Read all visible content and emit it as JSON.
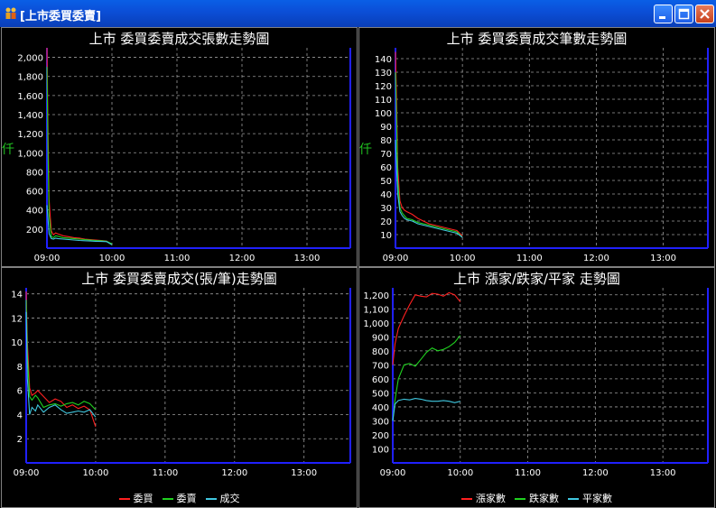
{
  "window": {
    "title": "[上市委買委賣]"
  },
  "panels": [
    {
      "title": "上市  委買委賣成交張數走勢圖",
      "ylabel": "仟",
      "legend": [],
      "chart_data": {
        "type": "line",
        "title": "上市  委買委賣成交張數走勢圖",
        "ylabel": "仟",
        "x_ticks": [
          "09:00",
          "10:00",
          "11:00",
          "12:00",
          "13:00"
        ],
        "x_range": [
          "09:00",
          "13:40"
        ],
        "y_ticks": [
          200,
          400,
          600,
          800,
          1000,
          1200,
          1400,
          1600,
          1800,
          2000
        ],
        "y_tick_labels": [
          "200",
          "400",
          "600",
          "800",
          "1,000",
          "1,200",
          "1,400",
          "1,600",
          "1,800",
          "2,000"
        ],
        "ylim": [
          0,
          2100
        ],
        "grid": true,
        "series": [
          {
            "color": "#ff2020",
            "x": [
              "09:00",
              "09:01",
              "09:02",
              "09:04",
              "09:06",
              "09:08",
              "09:10",
              "09:15",
              "09:20",
              "09:25",
              "09:30",
              "09:35",
              "09:40",
              "09:45",
              "09:50",
              "09:55",
              "10:00"
            ],
            "values": [
              2100,
              1200,
              500,
              180,
              140,
              160,
              150,
              130,
              120,
              110,
              105,
              95,
              90,
              85,
              80,
              75,
              40
            ]
          },
          {
            "color": "#20d020",
            "x": [
              "09:00",
              "09:01",
              "09:02",
              "09:04",
              "09:06",
              "09:08",
              "09:10",
              "09:15",
              "09:20",
              "09:25",
              "09:30",
              "09:35",
              "09:40",
              "09:45",
              "09:50",
              "09:55",
              "10:00"
            ],
            "values": [
              1900,
              1000,
              350,
              120,
              110,
              130,
              125,
              110,
              105,
              100,
              95,
              90,
              85,
              80,
              78,
              72,
              45
            ]
          },
          {
            "color": "#40c8e0",
            "x": [
              "09:00",
              "09:01",
              "09:02",
              "09:04",
              "09:06",
              "09:08",
              "09:10",
              "09:15",
              "09:20",
              "09:25",
              "09:30",
              "09:35",
              "09:40",
              "09:45",
              "09:50",
              "09:55",
              "10:00"
            ],
            "values": [
              450,
              300,
              150,
              100,
              95,
              105,
              100,
              95,
              90,
              85,
              80,
              78,
              75,
              72,
              70,
              68,
              35
            ]
          }
        ]
      }
    },
    {
      "title": "上市  委買委賣成交筆數走勢圖",
      "ylabel": "仟",
      "legend": [],
      "chart_data": {
        "type": "line",
        "title": "上市  委買委賣成交筆數走勢圖",
        "ylabel": "仟",
        "x_ticks": [
          "09:00",
          "10:00",
          "11:00",
          "12:00",
          "13:00"
        ],
        "x_range": [
          "09:00",
          "13:40"
        ],
        "y_ticks": [
          10,
          20,
          30,
          40,
          50,
          60,
          70,
          80,
          90,
          100,
          110,
          120,
          130,
          140
        ],
        "y_tick_labels": [
          "10",
          "20",
          "30",
          "40",
          "50",
          "60",
          "70",
          "80",
          "90",
          "100",
          "110",
          "120",
          "130",
          "140"
        ],
        "ylim": [
          0,
          148
        ],
        "grid": true,
        "series": [
          {
            "color": "#ff2020",
            "x": [
              "09:00",
              "09:01",
              "09:02",
              "09:04",
              "09:06",
              "09:08",
              "09:10",
              "09:15",
              "09:20",
              "09:25",
              "09:30",
              "09:35",
              "09:40",
              "09:45",
              "09:50",
              "09:55",
              "10:00"
            ],
            "values": [
              145,
              110,
              60,
              35,
              30,
              28,
              27,
              25,
              22,
              20,
              18,
              17,
              16,
              15,
              14,
              13,
              9
            ]
          },
          {
            "color": "#20d020",
            "x": [
              "09:00",
              "09:01",
              "09:02",
              "09:04",
              "09:06",
              "09:08",
              "09:10",
              "09:15",
              "09:20",
              "09:25",
              "09:30",
              "09:35",
              "09:40",
              "09:45",
              "09:50",
              "09:55",
              "10:00"
            ],
            "values": [
              130,
              95,
              50,
              30,
              26,
              24,
              22,
              21,
              19,
              18,
              17,
              16,
              15,
              14,
              13,
              12,
              8
            ]
          },
          {
            "color": "#40c8e0",
            "x": [
              "09:00",
              "09:01",
              "09:02",
              "09:04",
              "09:06",
              "09:08",
              "09:10",
              "09:15",
              "09:20",
              "09:25",
              "09:30",
              "09:35",
              "09:40",
              "09:45",
              "09:50",
              "09:55",
              "10:00"
            ],
            "values": [
              80,
              60,
              40,
              27,
              24,
              22,
              21,
              20,
              18,
              17,
              16,
              15,
              14,
              13,
              12,
              11,
              8
            ]
          }
        ]
      }
    },
    {
      "title": "上市  委買委賣成交(張/筆)走勢圖",
      "ylabel": "",
      "legend": [
        {
          "label": "委買",
          "color": "#ff2020"
        },
        {
          "label": "委賣",
          "color": "#20d020"
        },
        {
          "label": "成交",
          "color": "#40c8e0"
        }
      ],
      "chart_data": {
        "type": "line",
        "title": "上市  委買委賣成交(張/筆)走勢圖",
        "x_ticks": [
          "09:00",
          "10:00",
          "11:00",
          "12:00",
          "13:00"
        ],
        "x_range": [
          "09:00",
          "13:40"
        ],
        "y_ticks": [
          2,
          4,
          6,
          8,
          10,
          12,
          14
        ],
        "y_tick_labels": [
          "2",
          "4",
          "6",
          "8",
          "10",
          "12",
          "14"
        ],
        "ylim": [
          0,
          14.5
        ],
        "grid": true,
        "series": [
          {
            "name": "委買",
            "color": "#ff2020",
            "x": [
              "09:00",
              "09:01",
              "09:03",
              "09:05",
              "09:08",
              "09:10",
              "09:15",
              "09:20",
              "09:25",
              "09:30",
              "09:35",
              "09:40",
              "09:45",
              "09:50",
              "09:55",
              "10:00"
            ],
            "values": [
              14.2,
              10,
              6.2,
              5.6,
              5.8,
              6.0,
              5.5,
              5.0,
              5.3,
              5.1,
              4.6,
              4.8,
              4.5,
              4.7,
              4.4,
              3.0
            ]
          },
          {
            "name": "委賣",
            "color": "#20d020",
            "x": [
              "09:00",
              "09:01",
              "09:03",
              "09:05",
              "09:08",
              "09:10",
              "09:15",
              "09:20",
              "09:25",
              "09:30",
              "09:35",
              "09:40",
              "09:45",
              "09:50",
              "09:55",
              "10:00"
            ],
            "values": [
              13.5,
              9,
              5.5,
              5.2,
              5.6,
              5.4,
              4.6,
              4.8,
              4.9,
              4.7,
              4.9,
              5.0,
              4.8,
              5.1,
              4.9,
              4.4
            ]
          },
          {
            "name": "成交",
            "color": "#40c8e0",
            "x": [
              "09:00",
              "09:01",
              "09:03",
              "09:05",
              "09:08",
              "09:10",
              "09:15",
              "09:20",
              "09:25",
              "09:30",
              "09:35",
              "09:40",
              "09:45",
              "09:50",
              "09:55",
              "10:00"
            ],
            "values": [
              12.5,
              7,
              4.0,
              4.6,
              4.3,
              4.8,
              4.2,
              4.6,
              4.8,
              4.4,
              4.1,
              4.2,
              4.3,
              4.2,
              4.4,
              3.8
            ]
          }
        ]
      }
    },
    {
      "title": "上市  漲家/跌家/平家  走勢圖",
      "ylabel": "",
      "legend": [
        {
          "label": "漲家數",
          "color": "#ff2020"
        },
        {
          "label": "跌家數",
          "color": "#20d020"
        },
        {
          "label": "平家數",
          "color": "#40c8e0"
        }
      ],
      "chart_data": {
        "type": "line",
        "title": "上市  漲家/跌家/平家  走勢圖",
        "x_ticks": [
          "09:00",
          "10:00",
          "11:00",
          "12:00",
          "13:00"
        ],
        "x_range": [
          "09:00",
          "13:40"
        ],
        "y_ticks": [
          100,
          200,
          300,
          400,
          500,
          600,
          700,
          800,
          900,
          1000,
          1100,
          1200
        ],
        "y_tick_labels": [
          "100",
          "200",
          "300",
          "400",
          "500",
          "600",
          "700",
          "800",
          "900",
          "1,000",
          "1,100",
          "1,200"
        ],
        "ylim": [
          0,
          1250
        ],
        "grid": true,
        "series": [
          {
            "name": "漲家數",
            "color": "#ff2020",
            "x": [
              "09:00",
              "09:02",
              "09:05",
              "09:10",
              "09:15",
              "09:20",
              "09:25",
              "09:30",
              "09:35",
              "09:40",
              "09:45",
              "09:50",
              "09:55",
              "10:00"
            ],
            "values": [
              700,
              850,
              960,
              1050,
              1130,
              1200,
              1190,
              1185,
              1210,
              1205,
              1190,
              1215,
              1200,
              1150
            ]
          },
          {
            "name": "跌家數",
            "color": "#20d020",
            "x": [
              "09:00",
              "09:02",
              "09:05",
              "09:10",
              "09:15",
              "09:20",
              "09:25",
              "09:30",
              "09:35",
              "09:40",
              "09:45",
              "09:50",
              "09:55",
              "10:00"
            ],
            "values": [
              300,
              450,
              600,
              700,
              710,
              690,
              740,
              790,
              820,
              800,
              810,
              830,
              860,
              910
            ]
          },
          {
            "name": "平家數",
            "color": "#40c8e0",
            "x": [
              "09:00",
              "09:02",
              "09:05",
              "09:10",
              "09:15",
              "09:20",
              "09:25",
              "09:30",
              "09:35",
              "09:40",
              "09:45",
              "09:50",
              "09:55",
              "10:00"
            ],
            "values": [
              300,
              420,
              445,
              455,
              450,
              460,
              455,
              445,
              440,
              440,
              445,
              440,
              430,
              440
            ]
          }
        ]
      }
    }
  ]
}
